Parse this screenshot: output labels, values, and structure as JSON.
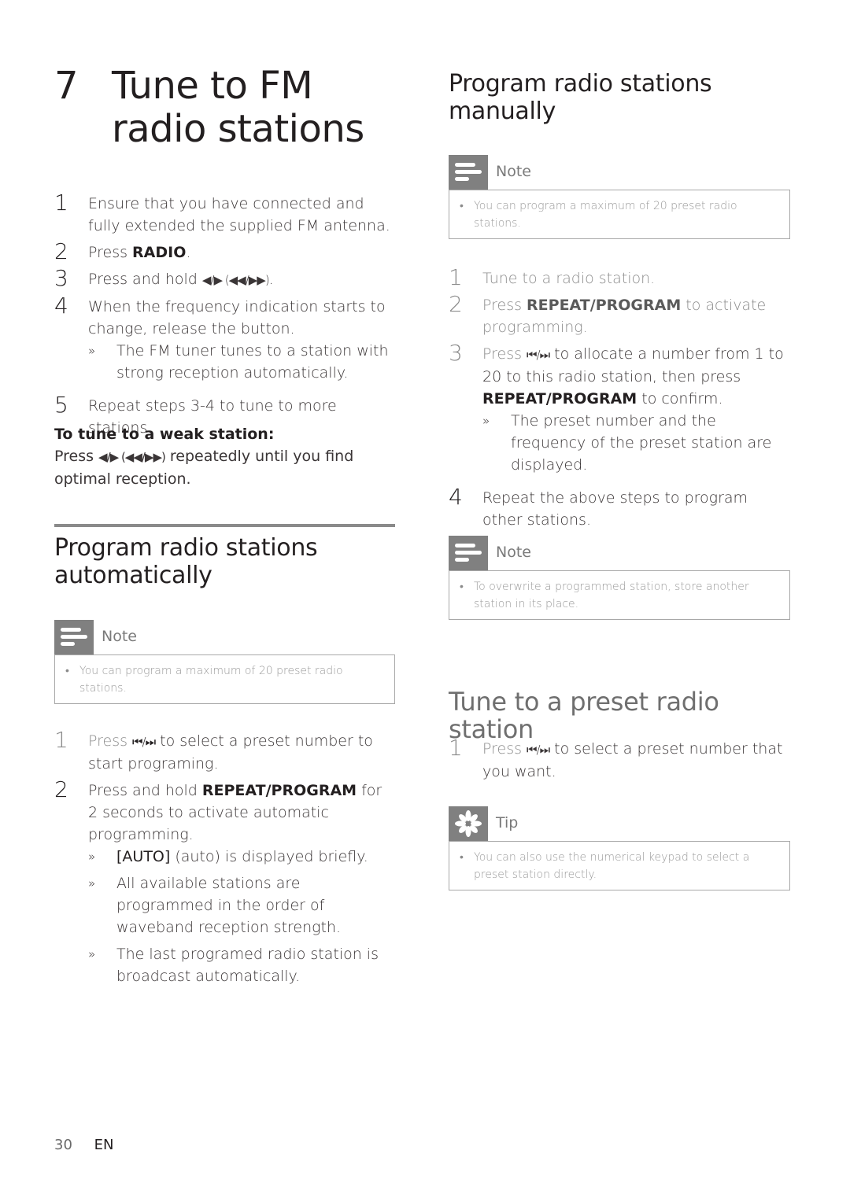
{
  "chapter": {
    "number": "7",
    "title": "Tune to FM radio stations"
  },
  "tune_steps": [
    {
      "n": "1",
      "text": "Ensure that you have connected and fully extended the supplied FM antenna."
    },
    {
      "n": "2",
      "pre": "Press ",
      "bold": "RADIO",
      "post": "."
    },
    {
      "n": "3",
      "pre": "Press and hold ",
      "sym": "◀/▶ (◀◀/▶▶)",
      "post": "."
    },
    {
      "n": "4",
      "text": "When the frequency indication starts to change, release the button.",
      "result": "The FM tuner tunes to a station with strong reception automatically."
    },
    {
      "n": "5",
      "text": "Repeat steps 3-4 to tune to more stations."
    }
  ],
  "weak_station": {
    "heading": "To tune to a weak station:",
    "pre": "Press ",
    "sym": "◀/▶ (◀◀/▶▶)",
    "post": " repeatedly until you find optimal reception."
  },
  "auto_section": {
    "title": "Program radio stations automatically",
    "note_label": "Note",
    "note_text": "You can program a maximum of 20 preset radio stations.",
    "steps": [
      {
        "n": "1",
        "pre": "Press ",
        "sym": "⏮/⏭",
        "post": " to select a preset number to start programing."
      },
      {
        "n": "2",
        "pre": "Press and hold ",
        "bold": "REPEAT/PROGRAM",
        "post": " for 2 seconds to activate automatic programming."
      }
    ],
    "results": [
      {
        "bold": "[AUTO]",
        "text": " (auto) is displayed briefly."
      },
      {
        "text": "All available stations are programmed in the order of waveband reception strength."
      },
      {
        "text": "The last programed radio station is broadcast automatically."
      }
    ]
  },
  "manual_section": {
    "title": "Program radio stations manually",
    "note_label": "Note",
    "note_text": "You can program a maximum of 20 preset radio stations.",
    "steps": [
      {
        "n": "1",
        "text": "Tune to a radio station."
      },
      {
        "n": "2",
        "pre": "Press ",
        "bold": "REPEAT/PROGRAM",
        "post": " to activate programming."
      },
      {
        "n": "3",
        "pre": "Press ",
        "sym": "⏮/⏭",
        "mid": " to allocate a number from 1 to 20 to this radio station, then press ",
        "bold": "REPEAT/PROGRAM",
        "post": " to confirm.",
        "result": "The preset number and the frequency of the preset station are displayed."
      },
      {
        "n": "4",
        "text": "Repeat the above steps to program other stations."
      }
    ],
    "note2_label": "Note",
    "note2_text": "To overwrite a programmed station, store another station in its place."
  },
  "preset_section": {
    "title": "Tune to a preset radio station",
    "steps": [
      {
        "n": "1",
        "pre": "Press ",
        "sym": "⏮/⏭",
        "post": " to select a preset number that you want."
      }
    ],
    "tip_label": "Tip",
    "tip_text": "You can also use the numerical keypad to select a preset station directly."
  },
  "footer": {
    "page": "30",
    "lang": "EN"
  },
  "result_marker": "»",
  "bullet": "•"
}
